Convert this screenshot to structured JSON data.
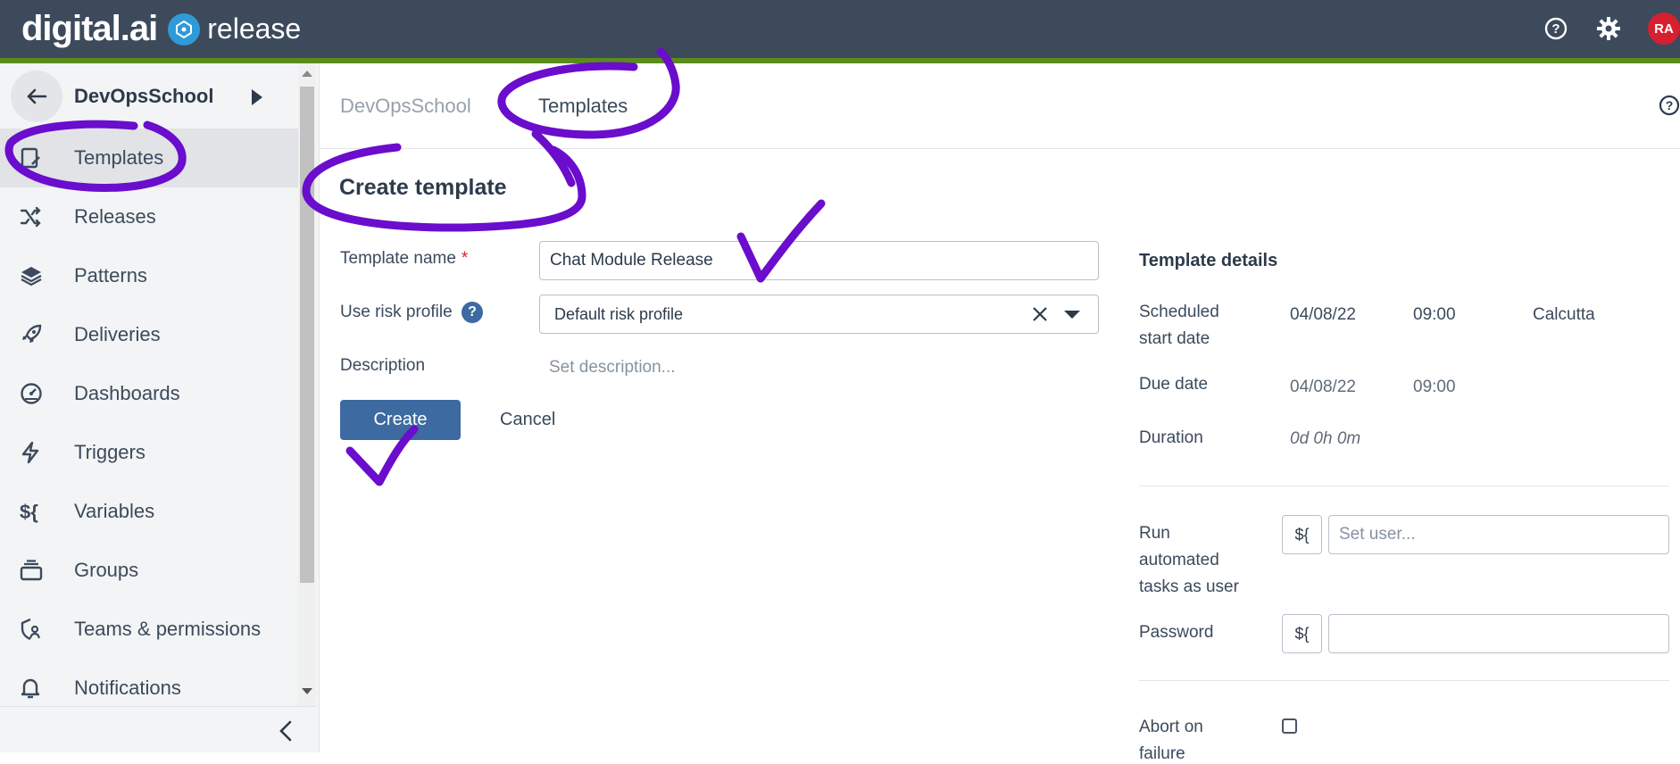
{
  "header": {
    "brand": "digital.ai",
    "product": "release",
    "avatar_initials": "RA",
    "colors": {
      "bar": "#3d4a5c",
      "accent": "#5a8c1c",
      "avatar": "#d6202f",
      "release_icon": "#2f9ad8"
    },
    "icons": [
      "help-icon",
      "settings-gear-icon"
    ]
  },
  "sidebar": {
    "folder_name": "DevOpsSchool",
    "items": [
      {
        "label": "Templates",
        "icon": "templates-icon",
        "active": true
      },
      {
        "label": "Releases",
        "icon": "shuffle-icon"
      },
      {
        "label": "Patterns",
        "icon": "layers-icon"
      },
      {
        "label": "Deliveries",
        "icon": "rocket-icon"
      },
      {
        "label": "Dashboards",
        "icon": "gauge-icon"
      },
      {
        "label": "Triggers",
        "icon": "lightning-icon"
      },
      {
        "label": "Variables",
        "icon": "variable-icon"
      },
      {
        "label": "Groups",
        "icon": "groups-icon"
      },
      {
        "label": "Teams & permissions",
        "icon": "team-shield-icon"
      },
      {
        "label": "Notifications",
        "icon": "bell-icon"
      }
    ]
  },
  "breadcrumb": {
    "parent": "DevOpsSchool",
    "current": "Templates"
  },
  "form": {
    "title": "Create template",
    "template_name_label": "Template name",
    "required_mark": "*",
    "template_name_value": "Chat Module Release",
    "risk_label": "Use risk profile",
    "risk_help": "?",
    "risk_value": "Default risk profile",
    "description_label": "Description",
    "description_placeholder": "Set description...",
    "create_label": "Create",
    "cancel_label": "Cancel",
    "primary_color": "#3d6aa1"
  },
  "details": {
    "title": "Template details",
    "start_label_1": "Scheduled",
    "start_label_2": "start date",
    "start_date": "04/08/22",
    "start_time": "09:00",
    "timezone": "Calcutta",
    "due_label": "Due date",
    "due_date": "04/08/22",
    "due_time": "09:00",
    "duration_label": "Duration",
    "duration_value": "0d 0h 0m",
    "run_label_1": "Run",
    "run_label_2": "automated",
    "run_label_3": "tasks as user",
    "var_button": "${",
    "user_placeholder": "Set user...",
    "password_label": "Password",
    "abort_label_1": "Abort on",
    "abort_label_2": "failure"
  },
  "annotations": {
    "color": "#6a0dcc"
  }
}
